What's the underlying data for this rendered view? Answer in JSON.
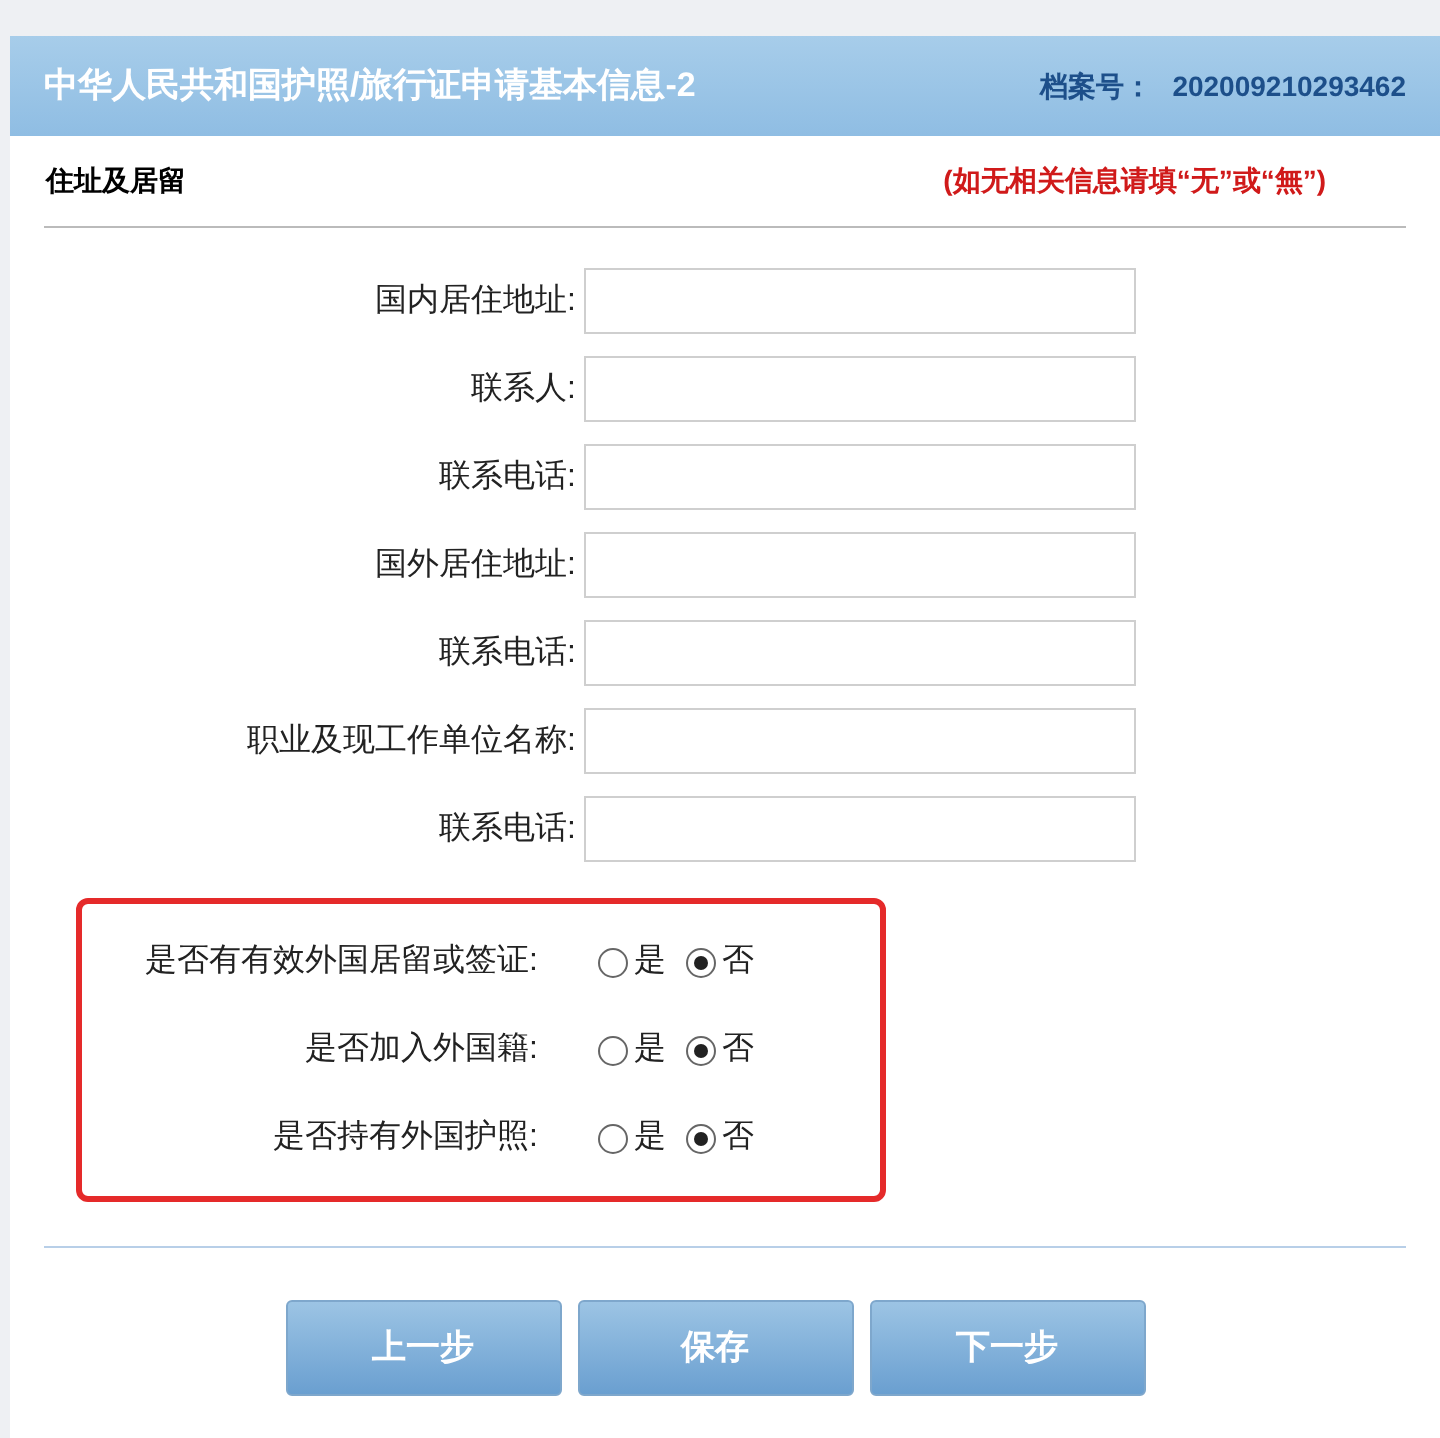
{
  "header": {
    "title": "中华人民共和国护照/旅行证申请基本信息-2",
    "file_label": "档案号：",
    "file_number": "202009210293462"
  },
  "section": {
    "title": "住址及居留",
    "note": "(如无相关信息请填“无”或“無”)"
  },
  "fields": [
    {
      "label": "国内居住地址:"
    },
    {
      "label": "联系人:"
    },
    {
      "label": "联系电话:"
    },
    {
      "label": "国外居住地址:"
    },
    {
      "label": "联系电话:"
    },
    {
      "label": "职业及现工作单位名称:"
    },
    {
      "label": "联系电话:"
    }
  ],
  "questions": [
    {
      "label": "是否有有效外国居留或签证:",
      "options": [
        {
          "label": "是",
          "selected": false
        },
        {
          "label": "否",
          "selected": true
        }
      ]
    },
    {
      "label": "是否加入外国籍:",
      "options": [
        {
          "label": "是",
          "selected": false
        },
        {
          "label": "否",
          "selected": true
        }
      ]
    },
    {
      "label": "是否持有外国护照:",
      "options": [
        {
          "label": "是",
          "selected": false
        },
        {
          "label": "否",
          "selected": true
        }
      ]
    }
  ],
  "buttons": [
    "上一步",
    "保存",
    "下一步"
  ]
}
